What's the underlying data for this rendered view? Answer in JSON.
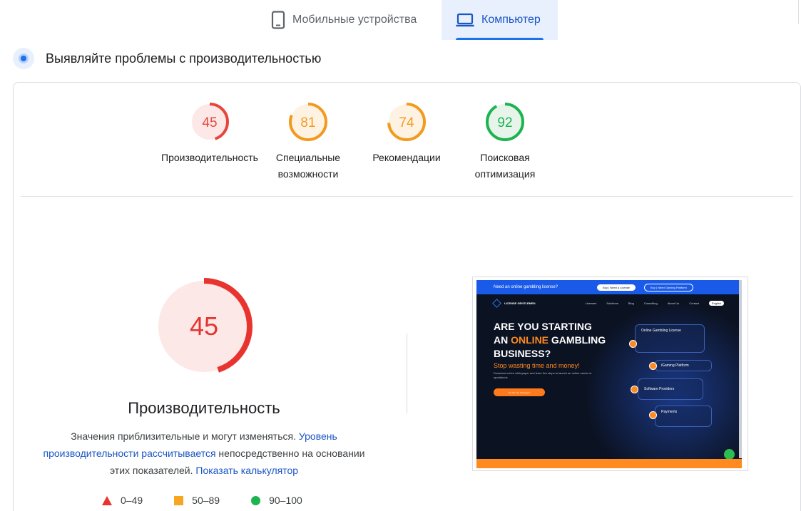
{
  "tabs": {
    "mobile": {
      "label": "Мобильные устройства",
      "icon": "smartphone-icon"
    },
    "desktop": {
      "label": "Компьютер",
      "icon": "laptop-icon",
      "active": true
    }
  },
  "diagnostics": {
    "title": "Выявляйте проблемы с производительностью",
    "icon": "diagnostic-icon"
  },
  "categories": [
    {
      "score": "45",
      "label_lines": [
        "Производительность"
      ],
      "color": "#e8453c",
      "fill": "#fce8e6"
    },
    {
      "score": "81",
      "label_lines": [
        "Специальные",
        "возможности"
      ],
      "color": "#f29a1f",
      "fill": "#fef3e3"
    },
    {
      "score": "74",
      "label_lines": [
        "Рекомендации"
      ],
      "color": "#f29a1f",
      "fill": "#fef3e3"
    },
    {
      "score": "92",
      "label_lines": [
        "Поисковая",
        "оптимизация"
      ],
      "color": "#1db34f",
      "fill": "#e6f4ea"
    }
  ],
  "performance": {
    "score": "45",
    "title": "Производительность",
    "note": {
      "text1": "Значения приблизительные и могут изменяться.",
      "link1": "Уровень производительности рассчитывается",
      "text2": "непосредственно на основании этих показателей.",
      "link2": "Показать калькулятор"
    }
  },
  "legend": [
    {
      "range": "0–49",
      "shape": "triangle",
      "color": "#e8342f"
    },
    {
      "range": "50–89",
      "shape": "square",
      "color": "#f6a623"
    },
    {
      "range": "90–100",
      "shape": "circle",
      "color": "#1db34f"
    }
  ],
  "thumbnail": {
    "topbar_text": "Need an online gambling license?",
    "topbar_btn1": "Buy | Need a License",
    "topbar_btn2": "Buy | Need Gaming Platform",
    "logo_text": "LICENSE GENTLEMEN",
    "nav": [
      "Licenses",
      "Solutions",
      "Blog",
      "Consulting",
      "About Us",
      "Contact"
    ],
    "lang": "English",
    "hero_line1": "ARE YOU STARTING",
    "hero_line2_a": "AN",
    "hero_line2_b": "ONLINE",
    "hero_line2_c": "GAMBLING",
    "hero_line3": "BUSINESS?",
    "hero_sub": "Stop wasting time and money!",
    "hero_small": "Download a free whitepaper and learn five steps to launch an online casino or sportsbook",
    "hero_cta": "Get the free whitepaper",
    "flow": [
      "Online Gambling License",
      "iGaming Platform",
      "Software Providers",
      "Payments"
    ]
  }
}
